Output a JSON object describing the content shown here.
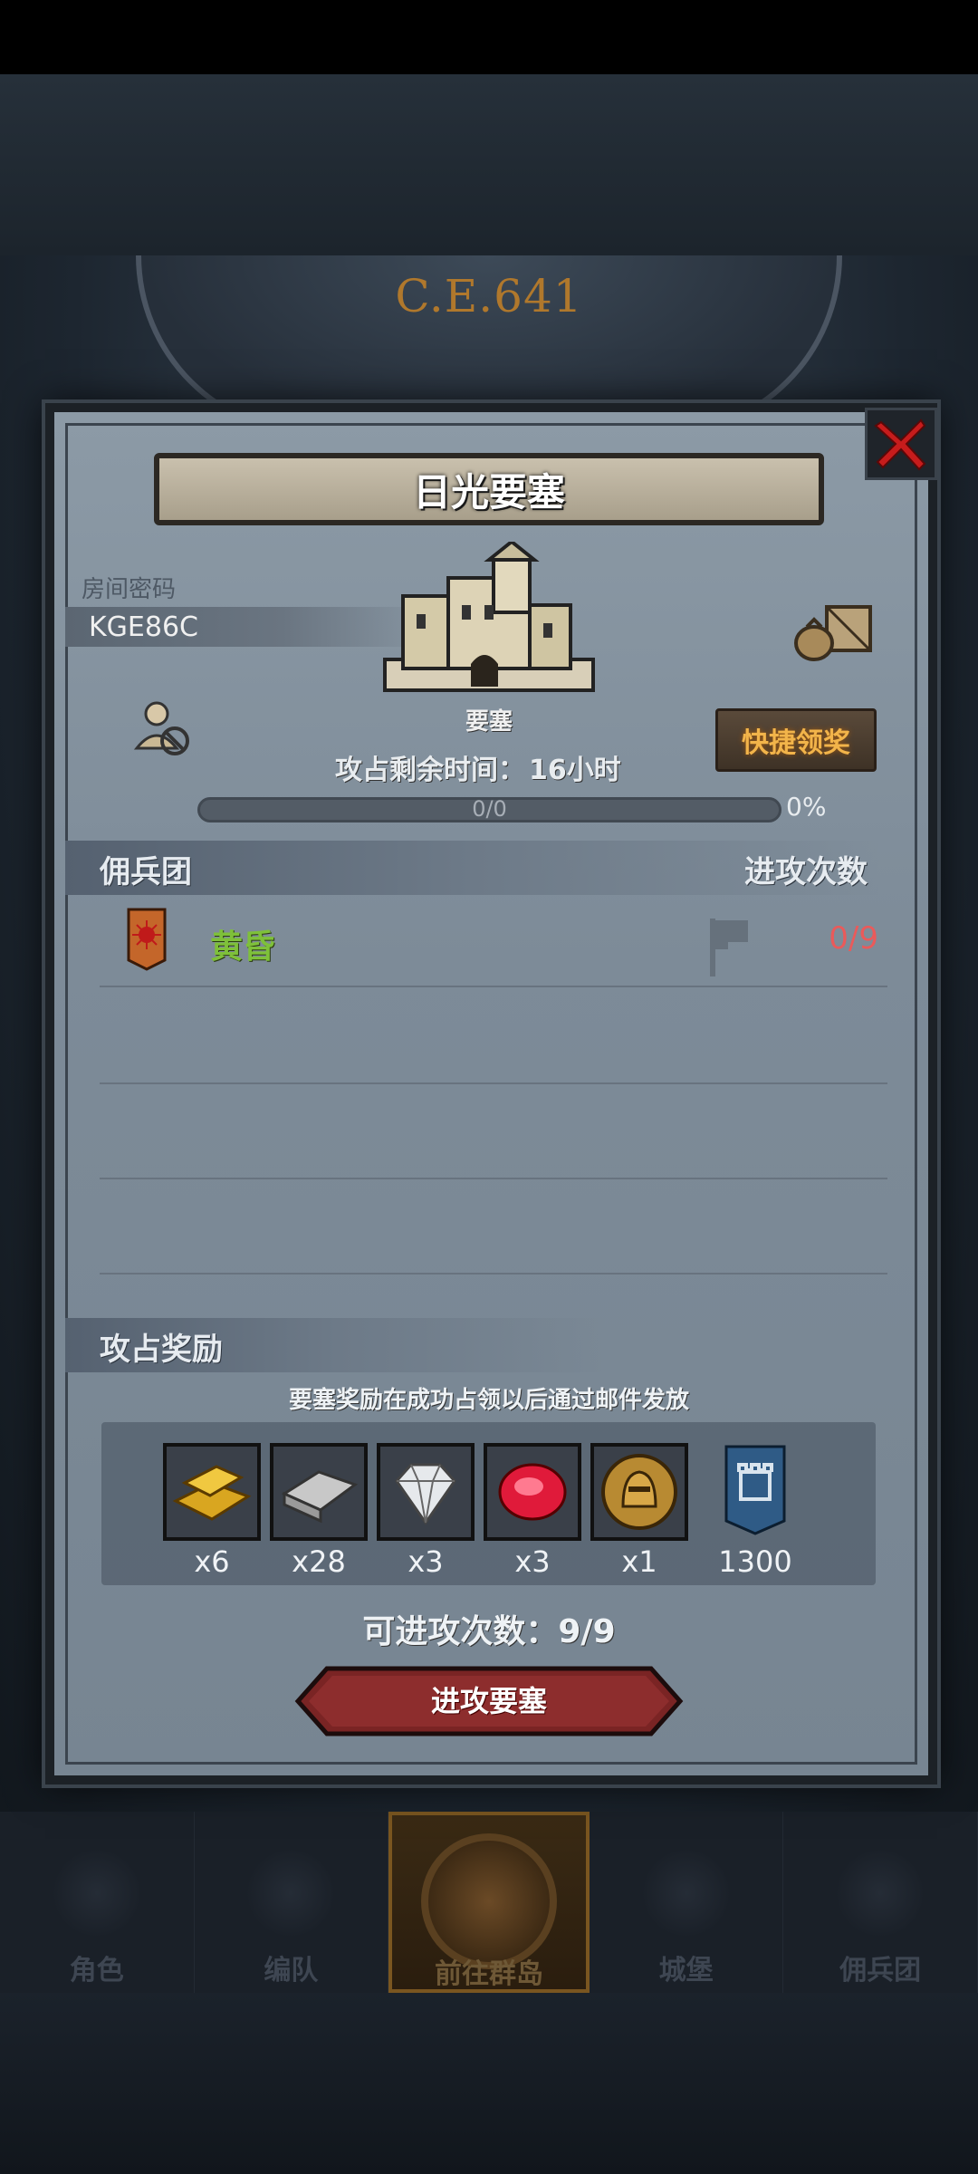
{
  "header": {
    "era": "C.E.641"
  },
  "dialog": {
    "title": "日光要塞",
    "room_label": "房间密码",
    "room_code": "KGE86C",
    "building_label": "要塞",
    "quick_claim_label": "快捷领奖",
    "timer_prefix": "攻占剩余时间：",
    "timer_value": "16小时",
    "progress_text": "0/0",
    "progress_fraction": 0,
    "progress_percent": "0%"
  },
  "mercenary_section": {
    "title": "佣兵团",
    "attacks_header": "进攻次数",
    "rows": [
      {
        "name": "黄昏",
        "attacks": "0/9"
      }
    ]
  },
  "reward_section": {
    "title": "攻占奖励",
    "note": "要塞奖励在成功占领以后通过邮件发放",
    "items": [
      {
        "icon": "gold-bar-icon",
        "count": "x6"
      },
      {
        "icon": "iron-ingot-icon",
        "count": "x28"
      },
      {
        "icon": "diamond-icon",
        "count": "x3"
      },
      {
        "icon": "ruby-icon",
        "count": "x3"
      },
      {
        "icon": "knight-medal-icon",
        "count": "x1"
      },
      {
        "icon": "fortress-badge-icon",
        "count": "1300"
      }
    ]
  },
  "attacks_remaining": "可进攻次数：9/9",
  "attack_button_label": "进攻要塞",
  "bottom_nav": [
    {
      "label": "角色"
    },
    {
      "label": "编队"
    },
    {
      "label": "前往群岛",
      "active": true
    },
    {
      "label": "城堡"
    },
    {
      "label": "佣兵团"
    }
  ],
  "colors": {
    "accent_gold": "#f2b44a",
    "merc_green": "#7ec03a",
    "attack_red": "#ea5a5a"
  }
}
